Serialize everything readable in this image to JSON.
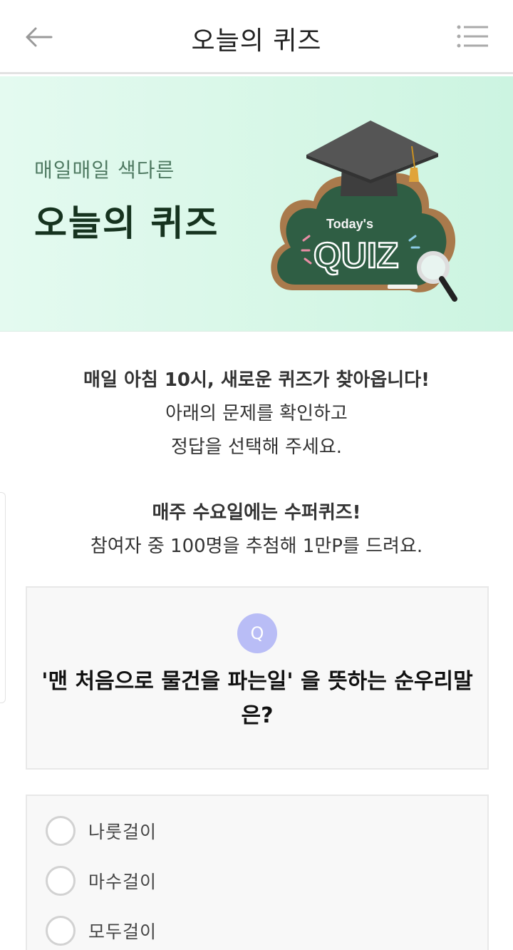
{
  "header": {
    "title": "오늘의 퀴즈",
    "back_icon": "arrow-left-icon",
    "menu_icon": "list-menu-icon"
  },
  "banner": {
    "subtitle": "매일매일 색다른",
    "title": "오늘의 퀴즈",
    "art_caption": "Today's",
    "art_word": "QUIZ"
  },
  "intro": {
    "line1": "매일 아침 10시, 새로운 퀴즈가 찾아옵니다!",
    "line2": "아래의 문제를 확인하고",
    "line3": "정답을 선택해 주세요."
  },
  "notice": {
    "line1": "매주 수요일에는 수퍼퀴즈!",
    "line2": "참여자 중 100명을 추첨해 1만P를 드려요."
  },
  "question": {
    "badge": "Q",
    "text": "'맨 처음으로 물건을 파는일' 을 뜻하는 순우리말은?"
  },
  "options": [
    {
      "label": "나룻걸이"
    },
    {
      "label": "마수걸이"
    },
    {
      "label": "모두걸이"
    }
  ],
  "colors": {
    "banner_bg": "#d7f7e7",
    "badge": "#b9bdf6",
    "title_dark_green": "#16331f"
  }
}
